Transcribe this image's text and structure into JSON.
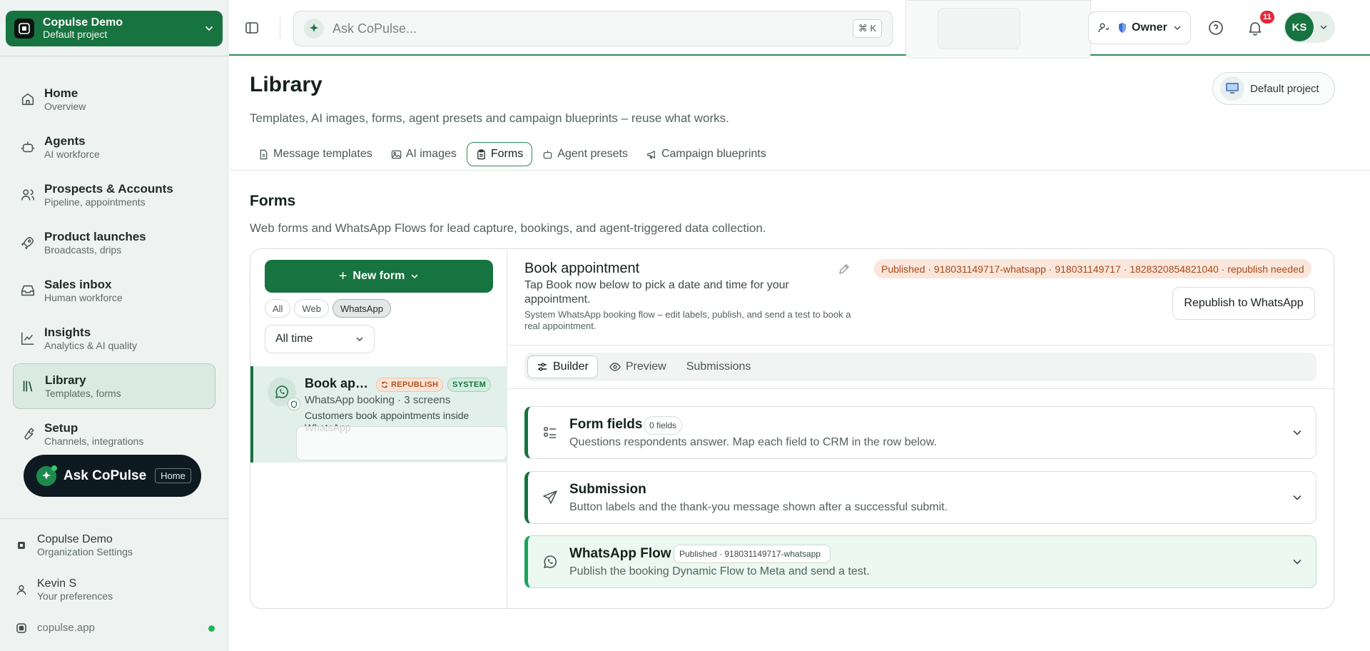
{
  "sidebar": {
    "org": {
      "name": "Copulse Demo",
      "project": "Default project"
    },
    "nav": [
      {
        "label": "Home",
        "sub": "Overview"
      },
      {
        "label": "Agents",
        "sub": "AI workforce"
      },
      {
        "label": "Prospects & Accounts",
        "sub": "Pipeline, appointments"
      },
      {
        "label": "Product launches",
        "sub": "Broadcasts, drips"
      },
      {
        "label": "Sales inbox",
        "sub": "Human workforce"
      },
      {
        "label": "Insights",
        "sub": "Analytics & AI quality"
      },
      {
        "label": "Library",
        "sub": "Templates, forms"
      },
      {
        "label": "Setup",
        "sub": "Channels, integrations"
      }
    ],
    "ask": {
      "label": "Ask CoPulse",
      "hint": "Home"
    },
    "footer": {
      "org_name": "Copulse Demo",
      "org_sub": "Organization Settings",
      "user_name": "Kevin S",
      "user_sub": "Your preferences",
      "domain": "copulse.app"
    }
  },
  "topbar": {
    "search_placeholder": "Ask CoPulse...",
    "search_shortcut": "⌘ K",
    "role": "Owner",
    "notifications": "11",
    "avatar_initials": "KS"
  },
  "page": {
    "title": "Library",
    "subtitle": "Templates, AI images, forms, agent presets and campaign blueprints – reuse what works.",
    "project_button": "Default project",
    "tabs": [
      "Message templates",
      "AI images",
      "Forms",
      "Agent presets",
      "Campaign blueprints"
    ],
    "active_tab": "Forms"
  },
  "forms_section": {
    "title": "Forms",
    "subtitle": "Web forms and WhatsApp Flows for lead capture, bookings, and agent-triggered data collection.",
    "new_form": "New form",
    "filters": [
      "All",
      "Web",
      "WhatsApp"
    ],
    "active_filter": "WhatsApp",
    "time_filter": "All time",
    "list": [
      {
        "name": "Book appointment",
        "badge_republish": "REPUBLISH",
        "badge_system": "SYSTEM",
        "meta": "WhatsApp booking · 3 screens",
        "desc": "Customers book appointments inside WhatsApp"
      }
    ]
  },
  "detail": {
    "title": "Book appointment",
    "subtitle": "Tap Book now below to pick a date and time for your appointment.",
    "note": "System WhatsApp booking flow – edit labels, publish, and send a test to book a real appointment.",
    "status": "Published · 918031149717-whatsapp · 918031149717 · 1828320854821040 · republish needed",
    "republish_button": "Republish to WhatsApp",
    "subtabs": [
      "Builder",
      "Preview",
      "Submissions"
    ],
    "active_subtab": "Builder",
    "sections": [
      {
        "title": "Form fields",
        "count": "0 fields",
        "desc": "Questions respondents answer. Map each field to CRM in the row below."
      },
      {
        "title": "Submission",
        "desc": "Button labels and the thank-you message shown after a successful submit."
      },
      {
        "title": "WhatsApp Flow",
        "status": "Published · 918031149717-whatsapp",
        "desc": "Publish the booking Dynamic Flow to Meta and send a test."
      }
    ]
  },
  "colors": {
    "brand_green": "#17733f",
    "sidebar_bg": "#eef3f1",
    "warning_bg": "#fbe6dc",
    "warning_text": "#a84a16",
    "badge_red": "#e5293b"
  },
  "icons": {
    "nav": [
      "home-icon",
      "bot-icon",
      "users-icon",
      "rocket-icon",
      "inbox-icon",
      "chart-icon",
      "library-icon",
      "wrench-icon"
    ]
  }
}
